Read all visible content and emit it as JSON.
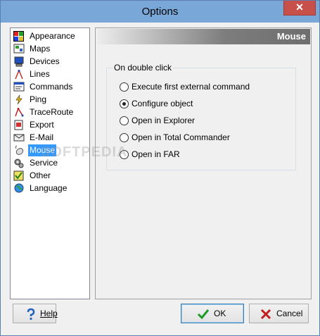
{
  "window": {
    "title": "Options",
    "close_glyph": "✕"
  },
  "tree": {
    "items": [
      {
        "label": "Appearance",
        "icon": "appearance-icon"
      },
      {
        "label": "Maps",
        "icon": "maps-icon"
      },
      {
        "label": "Devices",
        "icon": "devices-icon"
      },
      {
        "label": "Lines",
        "icon": "lines-icon"
      },
      {
        "label": "Commands",
        "icon": "commands-icon"
      },
      {
        "label": "Ping",
        "icon": "ping-icon"
      },
      {
        "label": "TraceRoute",
        "icon": "traceroute-icon"
      },
      {
        "label": "Export",
        "icon": "export-icon"
      },
      {
        "label": "E-Mail",
        "icon": "email-icon"
      },
      {
        "label": "Mouse",
        "icon": "mouse-icon"
      },
      {
        "label": "Service",
        "icon": "service-icon"
      },
      {
        "label": "Other",
        "icon": "other-icon"
      },
      {
        "label": "Language",
        "icon": "language-icon"
      }
    ],
    "selected": "Mouse"
  },
  "panel": {
    "header": "Mouse",
    "group_title": "On double click",
    "options": [
      {
        "label": "Execute first external command",
        "checked": false
      },
      {
        "label": "Configure object",
        "checked": true
      },
      {
        "label": "Open in Explorer",
        "checked": false
      },
      {
        "label": "Open in Total Commander",
        "checked": false
      },
      {
        "label": "Open in FAR",
        "checked": false
      }
    ]
  },
  "buttons": {
    "help": "Help",
    "ok": "OK",
    "cancel": "Cancel"
  },
  "watermark": "SOFTPEDIA",
  "colors": {
    "titlebar": "#78a7d8",
    "selection": "#3399ff",
    "close": "#c7504a"
  }
}
